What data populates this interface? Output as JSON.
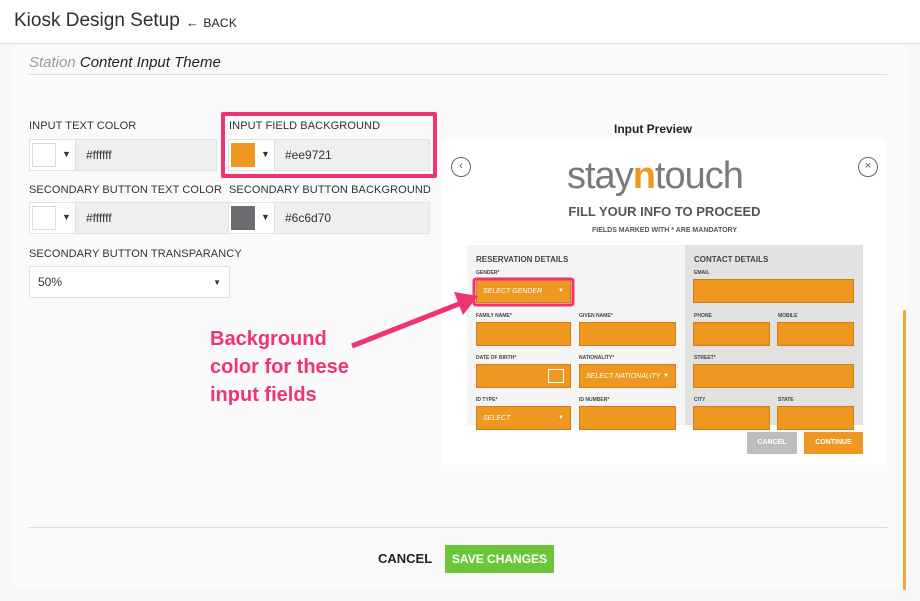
{
  "header": {
    "title": "Kiosk Design Setup",
    "back_label": "BACK"
  },
  "section": {
    "title_muted": "Station",
    "title_main": "Content Input Theme"
  },
  "fields": {
    "input_text_color": {
      "label": "INPUT TEXT COLOR",
      "value": "#ffffff",
      "color": "#ffffff"
    },
    "input_field_background": {
      "label": "INPUT FIELD BACKGROUND",
      "value": "#ee9721",
      "color": "#ee9721"
    },
    "secondary_button_text_color": {
      "label": "SECONDARY BUTTON TEXT COLOR",
      "value": "#ffffff",
      "color": "#ffffff"
    },
    "secondary_button_background": {
      "label": "SECONDARY BUTTON BACKGROUND",
      "value": "#6c6d70",
      "color": "#6c6d70"
    },
    "secondary_button_transparancy": {
      "label": "SECONDARY BUTTON TRANSPARANCY",
      "value": "50%"
    }
  },
  "preview": {
    "title": "Input Preview",
    "logo_part1": "stay",
    "logo_part2": "n",
    "logo_part3": "touch",
    "heading": "FILL YOUR INFO TO PROCEED",
    "subheading": "FIELDS MARKED WITH * ARE MANDATORY",
    "reservation_details": "RESERVATION DETAILS",
    "contact_details": "CONTACT DETAILS",
    "labels": {
      "gender": "GENDER*",
      "family_name": "FAMILY NAME*",
      "given_name": "GIVEN NAME*",
      "date_of_birth": "DATE OF BIRTH*",
      "nationality": "NATIONALITY*",
      "id_type": "ID TYPE*",
      "id_number": "ID NUMBER*",
      "email": "EMAIL",
      "phone": "PHONE",
      "mobile": "MOBILE",
      "street": "STREET*",
      "city": "CITY",
      "state": "STATE"
    },
    "placeholders": {
      "gender": "SELECT GENDER",
      "nationality": "SELECT NATIONALITY",
      "id_type": "SELECT"
    },
    "cancel_label": "CANCEL",
    "continue_label": "CONTINUE"
  },
  "annotation": {
    "line1": "Background",
    "line2": "color for these",
    "line3": "input fields"
  },
  "footer": {
    "cancel_label": "CANCEL",
    "save_label": "SAVE CHANGES"
  },
  "icons": {
    "back": "arrow-left-icon",
    "caret": "caret-down-icon",
    "prev": "chevron-left-circle-icon",
    "close": "close-circle-icon",
    "calendar": "calendar-icon"
  },
  "colors": {
    "accent": "#ee9721",
    "highlight": "#f0346e",
    "save": "#6cc63a"
  }
}
